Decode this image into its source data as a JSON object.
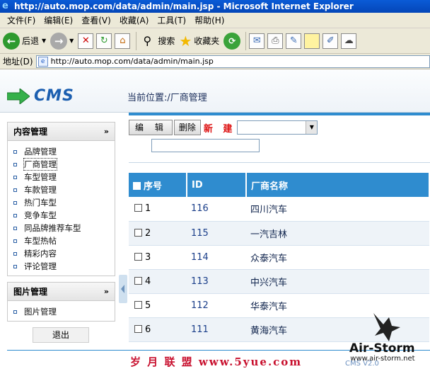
{
  "window": {
    "title": "http://auto.mop.com/data/admin/main.jsp - Microsoft Internet Explorer"
  },
  "menu": [
    "文件(F)",
    "编辑(E)",
    "查看(V)",
    "收藏(A)",
    "工具(T)",
    "帮助(H)"
  ],
  "toolbar": {
    "back_label": "后退",
    "search_label": "搜索",
    "favorites_label": "收藏夹"
  },
  "address": {
    "label": "地址(D)",
    "url": "http://auto.mop.com/data/admin/main.jsp"
  },
  "header": {
    "logo_text": "CMS",
    "location": "当前位置:/厂商管理"
  },
  "sidebar": {
    "content_panel": {
      "title": "内容管理",
      "items": [
        "品牌管理",
        "厂商管理",
        "车型管理",
        "车款管理",
        "热门车型",
        "竞争车型",
        "同品牌推荐车型",
        "车型热帖",
        "精彩内容",
        "评论管理"
      ]
    },
    "image_panel": {
      "title": "图片管理",
      "items": [
        "图片管理"
      ]
    },
    "logout_label": "退出"
  },
  "actions": {
    "edit_label": "编 辑",
    "delete_label": "删除",
    "new_label": "新 建"
  },
  "table": {
    "headers": [
      "序号",
      "ID",
      "厂商名称"
    ],
    "rows": [
      {
        "seq": "1",
        "id": "116",
        "name": "四川汽车"
      },
      {
        "seq": "2",
        "id": "115",
        "name": "一汽吉林"
      },
      {
        "seq": "3",
        "id": "114",
        "name": "众泰汽车"
      },
      {
        "seq": "4",
        "id": "113",
        "name": "中兴汽车"
      },
      {
        "seq": "5",
        "id": "112",
        "name": "华泰汽车"
      },
      {
        "seq": "6",
        "id": "111",
        "name": "黄海汽车"
      }
    ]
  },
  "footer": {
    "watermark": "岁 月 联 盟   www.5yue.com",
    "cms_version": "CMS V2.0",
    "brand_name": "Air-Storm",
    "brand_url": "www.air-storm.net"
  }
}
